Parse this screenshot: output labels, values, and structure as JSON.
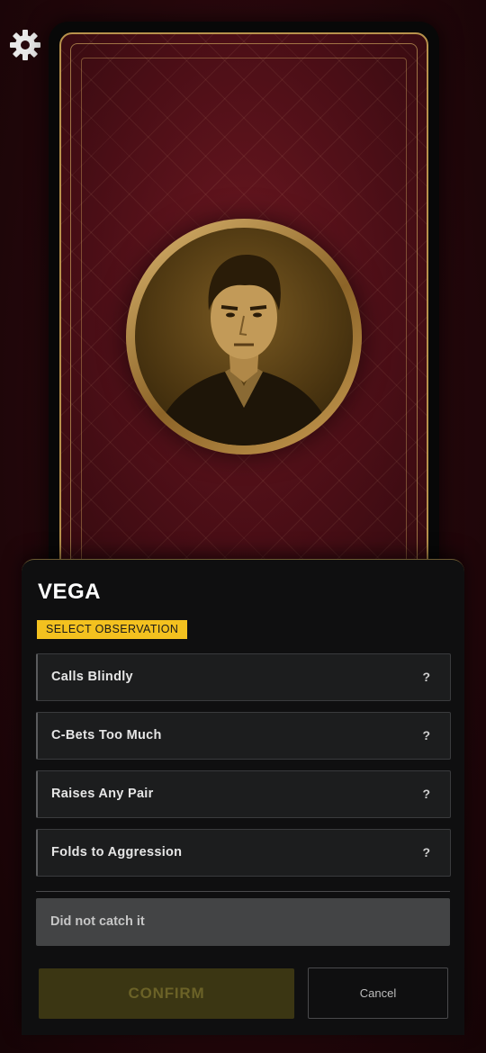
{
  "settings": {
    "icon": "gear-icon"
  },
  "card": {
    "portrait": "character-portrait"
  },
  "panel": {
    "title": "VEGA",
    "badge": "SELECT OBSERVATION",
    "options": [
      {
        "label": "Calls Blindly",
        "help": "?"
      },
      {
        "label": "C-Bets Too Much",
        "help": "?"
      },
      {
        "label": "Raises Any Pair",
        "help": "?"
      },
      {
        "label": "Folds to Aggression",
        "help": "?"
      }
    ],
    "miss_label": "Did not catch it",
    "confirm_label": "CONFIRM",
    "cancel_label": "Cancel"
  },
  "colors": {
    "accent_gold": "#f3c11f",
    "card_red": "#4a0e16",
    "frame_gold": "#b8924c",
    "panel_bg": "#0f0f10"
  }
}
